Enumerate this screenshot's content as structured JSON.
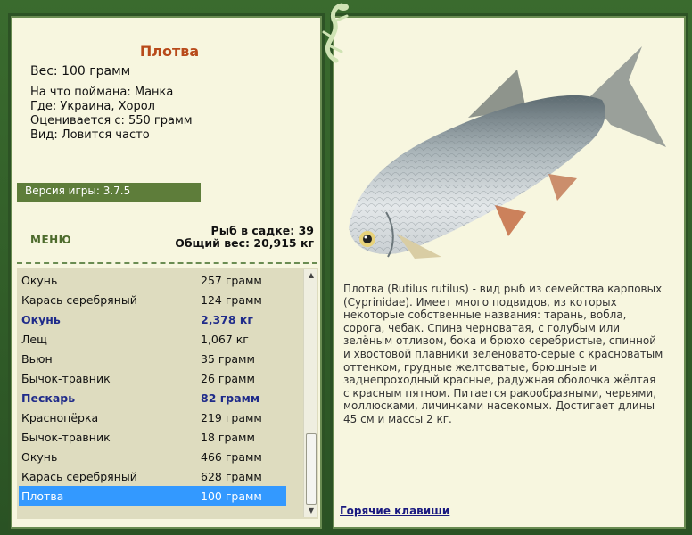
{
  "fish": {
    "name": "Плотва",
    "weight_line": "Вес: 100 грамм",
    "bait": "На что поймана: Манка",
    "location": "Где: Украина, Хорол",
    "value": "Оценивается с: 550 грамм",
    "kind": "Вид: Ловится часто",
    "description": "Плотва (Rutilus rutilus) - вид рыб из семейства карповых (Cyprinidae). Имеет много подвидов, из которых некоторые собственные названия: тарань, вобла, сорога, чебак. Спина черноватая, с голубым или зелёным отливом, бока и брюхо серебристые, спинной и хвостовой плавники зеленовато-серые с красноватым оттенком, грудные желтоватые, брюшные и заднепроходный красные, радужная оболочка жёлтая с красным пятном. Питается ракообразными, червями, моллюсками, личинками насекомых. Достигает длины 45 см и массы 2 кг."
  },
  "version": "Версия игры: 3.7.5",
  "menu_label": "МЕНЮ",
  "stats": {
    "count": "Рыб в садке: 39",
    "total": "Общий вес: 20,915 кг"
  },
  "catch_list": [
    {
      "name": "Окунь",
      "weight": "257 грамм",
      "style": "normal"
    },
    {
      "name": "Карась серебряный",
      "weight": "124 грамм",
      "style": "normal"
    },
    {
      "name": "Окунь",
      "weight": "2,378 кг",
      "style": "bold"
    },
    {
      "name": "Лещ",
      "weight": "1,067 кг",
      "style": "normal"
    },
    {
      "name": "Вьюн",
      "weight": "35 грамм",
      "style": "normal"
    },
    {
      "name": "Бычок-травник",
      "weight": "26 грамм",
      "style": "normal"
    },
    {
      "name": "Пескарь",
      "weight": "82 грамм",
      "style": "bold"
    },
    {
      "name": "Краснопёрка",
      "weight": "219 грамм",
      "style": "normal"
    },
    {
      "name": "Бычок-травник",
      "weight": "18 грамм",
      "style": "normal"
    },
    {
      "name": "Окунь",
      "weight": "466 грамм",
      "style": "normal"
    },
    {
      "name": "Карась серебряный",
      "weight": "628 грамм",
      "style": "normal"
    },
    {
      "name": "Плотва",
      "weight": "100 грамм",
      "style": "selected"
    }
  ],
  "hotkeys_label": "Горячие клавиши",
  "colors": {
    "frame_green": "#2e5a26",
    "panel_bg": "#f7f6df",
    "title_orange": "#b84a1a",
    "bold_blue": "#1f2b8a",
    "selection_blue": "#3399ff"
  }
}
